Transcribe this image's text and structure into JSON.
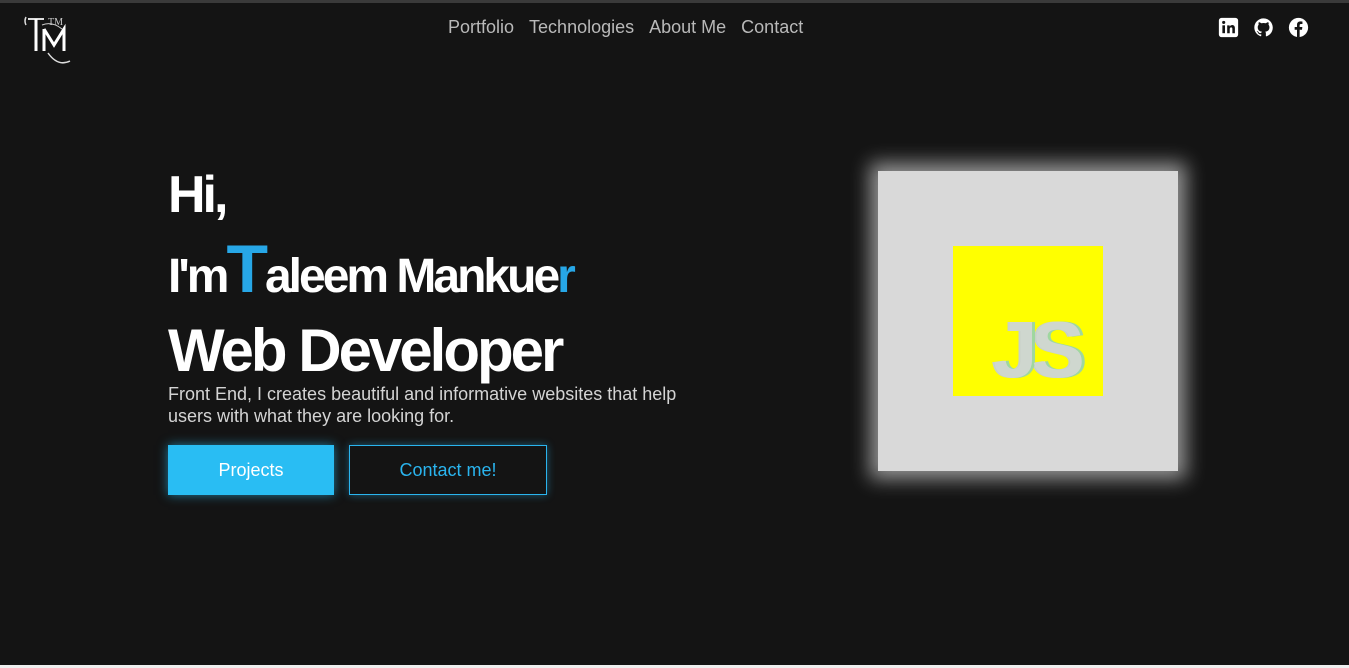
{
  "logo": {
    "text": "TM"
  },
  "nav": {
    "items": [
      "Portfolio",
      "Technologies",
      "About Me",
      "Contact"
    ]
  },
  "socials": [
    "linkedin-icon",
    "github-icon",
    "facebook-icon"
  ],
  "hero": {
    "greeting": "Hi,",
    "name_prefix": "I'm",
    "name_first_letter": "T",
    "name_middle": "aleem Mankue",
    "name_last_letter": "r",
    "role": "Web Developer",
    "description": "Front End, I creates beautiful and informative websites that help users with what they are looking for.",
    "primary_button": "Projects",
    "secondary_button": "Contact me!"
  },
  "tech": {
    "label": "JS"
  },
  "colors": {
    "accent": "#29bdf3",
    "background": "#141414",
    "js_yellow": "#ffff00"
  }
}
